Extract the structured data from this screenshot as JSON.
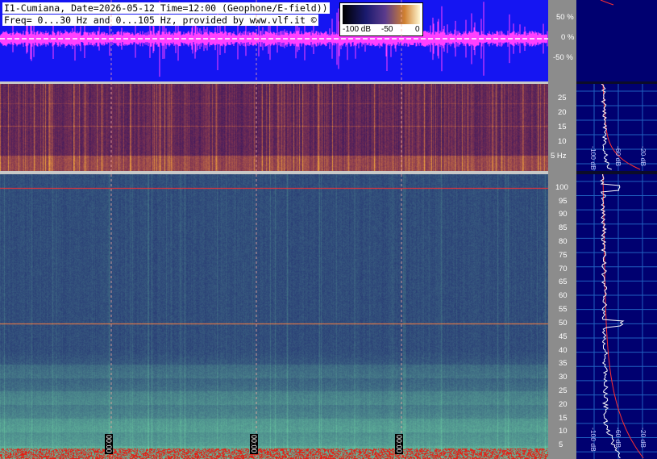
{
  "header": {
    "title_line1": "I1-Cumiana, Date=2026-05-12 Time=12:00 (Geophone/E-field))",
    "title_line2": "Freq= 0...30 Hz and 0...105 Hz, provided by www.vlf.it ©"
  },
  "colorbar": {
    "labels": [
      "-100 dB",
      "-50",
      "0"
    ]
  },
  "waveform_axis": {
    "ticks": [
      "50 %",
      "0 %",
      "-50 %"
    ]
  },
  "chart_data": [
    {
      "type": "area",
      "panel": "waveform",
      "ylim": [
        -100,
        100
      ],
      "yunit": "%",
      "colors": {
        "background": "#1515f2",
        "signal": "#ff40ff",
        "center": "#ffffff"
      }
    },
    {
      "type": "heatmap",
      "panel": "spectrogram-low",
      "ylim": [
        0,
        30
      ],
      "ticks": [
        "25",
        "20",
        "15",
        "10",
        "5 Hz"
      ],
      "tick_values": [
        25,
        20,
        15,
        10,
        5
      ],
      "colormap": [
        "#000000",
        "#1a1a6e",
        "#5b3b8c",
        "#d08030",
        "#fff6d0"
      ]
    },
    {
      "type": "heatmap",
      "panel": "spectrogram-high",
      "ylim": [
        0,
        105
      ],
      "ticks": [
        "100",
        "95",
        "90",
        "85",
        "80",
        "75",
        "70",
        "65",
        "60",
        "55",
        "50",
        "45",
        "40",
        "35",
        "30",
        "25",
        "20",
        "15",
        "10",
        "5"
      ],
      "tick_values": [
        100,
        95,
        90,
        85,
        80,
        75,
        70,
        65,
        60,
        55,
        50,
        45,
        40,
        35,
        30,
        25,
        20,
        15,
        10,
        5
      ],
      "time_labels": [
        "00:00",
        "00:00",
        "00:00"
      ],
      "hlines": [
        {
          "freq": 100,
          "color": "#ff3030"
        },
        {
          "freq": 50,
          "color": "#ff8040"
        }
      ],
      "colormap": [
        "#20206a",
        "#3a58a8",
        "#5aa8a8",
        "#90e0a0",
        "#ff2020"
      ]
    },
    {
      "type": "line",
      "panel": "side-spectrum-low",
      "xlabels": [
        "-100 dB",
        "-60 dB",
        "-20 dB"
      ]
    },
    {
      "type": "line",
      "panel": "side-spectrum-high",
      "xlabels": [
        "-100 dB",
        "-60 dB",
        "-20 dB"
      ],
      "peaks_hz": [
        100,
        50
      ]
    }
  ]
}
